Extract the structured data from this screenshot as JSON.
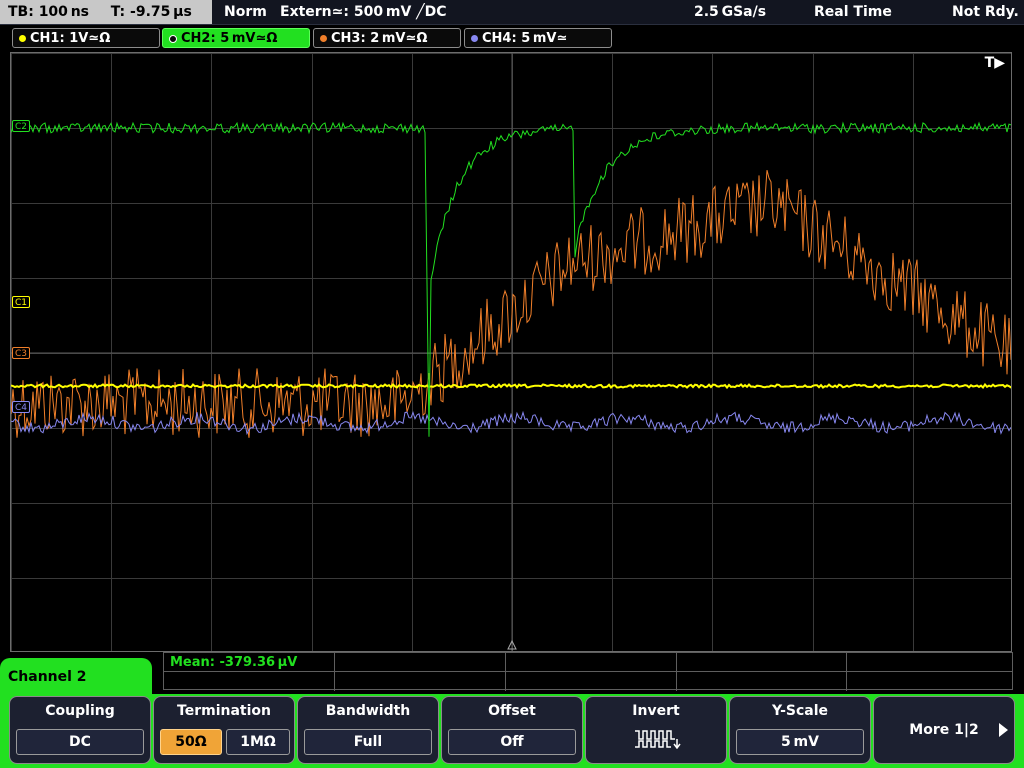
{
  "status_bar": {
    "timebase": "TB: 100 ns",
    "trigger_time": "T: -9.75 µs",
    "trigger_mode": "Norm",
    "trigger_source": "Extern≃: 500 mV ╱DC",
    "sample_rate": "2.5 GSa/s",
    "acq_mode": "Real Time",
    "acq_status": "Not Rdy."
  },
  "channels": [
    {
      "label": "CH1: 1V≃Ω",
      "color": "#ffff00",
      "active": false,
      "marker": "C1"
    },
    {
      "label": "CH2: 5 mV≃Ω",
      "color": "#22e020",
      "active": true,
      "marker": "C2"
    },
    {
      "label": "CH3: 2 mV≃Ω",
      "color": "#f07f2a",
      "active": false,
      "marker": "C3"
    },
    {
      "label": "CH4: 5 mV≃",
      "color": "#8888f0",
      "active": false,
      "marker": "C4"
    }
  ],
  "trigger_marker": "T▶",
  "measurement": {
    "label": "Mean: -379.36 µV"
  },
  "menu": {
    "title": "Channel 2",
    "softkeys": [
      {
        "title": "Coupling",
        "values": [
          "DC"
        ]
      },
      {
        "title": "Termination",
        "values": [
          "50Ω",
          "1MΩ"
        ],
        "selected": "50Ω"
      },
      {
        "title": "Bandwidth",
        "values": [
          "Full"
        ]
      },
      {
        "title": "Offset",
        "values": [
          "Off"
        ]
      },
      {
        "title": "Invert",
        "values": []
      },
      {
        "title": "Y-Scale",
        "values": [
          "5 mV"
        ]
      }
    ],
    "more": "More 1|2"
  },
  "colors": {
    "ch1": "#ffff00",
    "ch2": "#22e020",
    "ch3": "#f07f2a",
    "ch4": "#8888f0",
    "grid": "#3a3a3a"
  }
}
